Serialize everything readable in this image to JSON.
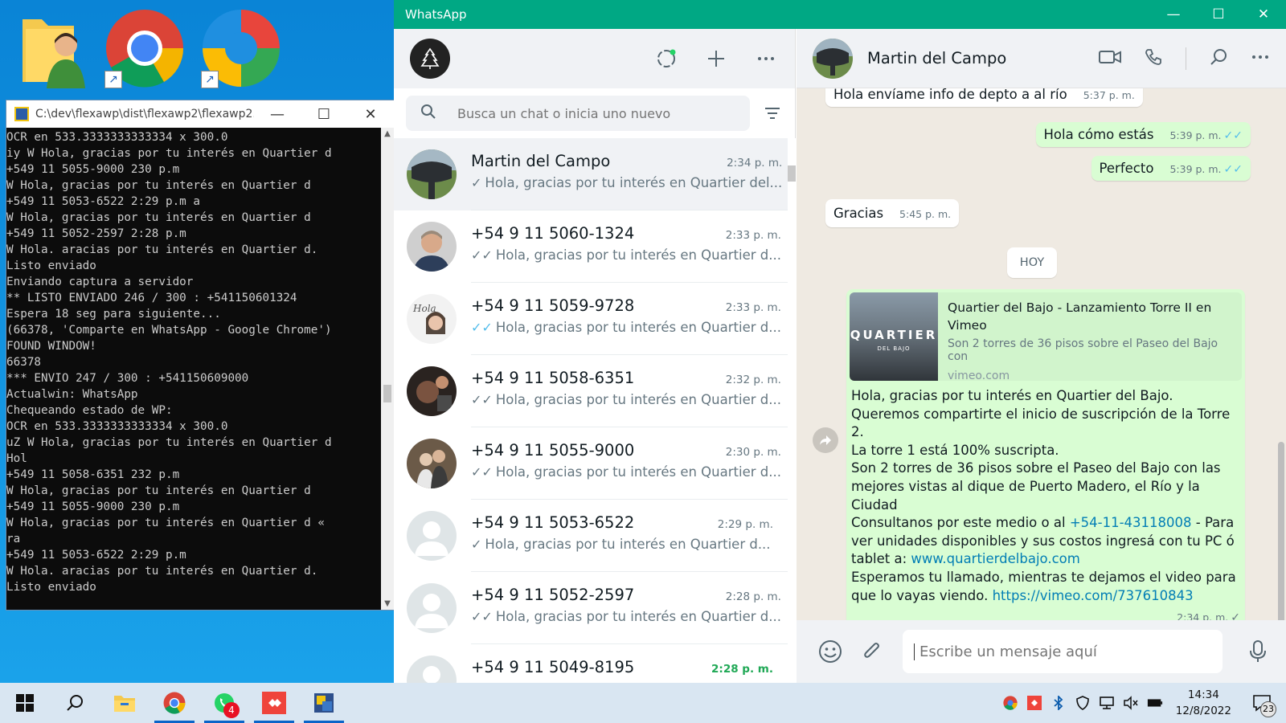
{
  "desktop": {
    "icons": [
      "user-folder-icon",
      "chrome-icon",
      "edge-icon"
    ]
  },
  "console": {
    "title": "C:\\dev\\flexawp\\dist\\flexawp2\\flexawp2....",
    "lines": [
      "OCR en 533.3333333333334 x 300.0",
      "iy W Hola, gracias por tu interés en Quartier d",
      "+549 11 5055-9000 230 p.m",
      "W Hola, gracias por tu interés en Quartier d",
      "+549 11 5053-6522 2:29 p.m a",
      "W Hola, gracias por tu interés en Quartier d",
      "+549 11 5052-2597 2:28 p.m",
      "W Hola. aracias por tu interés en Quartier d.",
      "Listo enviado",
      "Enviando captura a servidor",
      "** LISTO ENVIADO 246 / 300 : +541150601324",
      "Espera 18 seg para siguiente...",
      "(66378, 'Comparte en WhatsApp - Google Chrome')",
      "FOUND WINDOW!",
      "66378",
      "*** ENVIO 247 / 300 : +541150609000",
      "Actualwin: WhatsApp",
      "Chequeando estado de WP:",
      "OCR en 533.3333333333334 x 300.0",
      "uZ W Hola, gracias por tu interés en Quartier d",
      "Hol",
      "+549 11 5058-6351 232 p.m",
      "W Hola, gracias por tu interés en Quartier d",
      "+549 11 5055-9000 230 p.m",
      "W Hola, gracias por tu interés en Quartier d «",
      "ra",
      "+549 11 5053-6522 2:29 p.m",
      "W Hola. aracias por tu interés en Quartier d.",
      "Listo enviado"
    ]
  },
  "whatsapp": {
    "title": "WhatsApp",
    "search_placeholder": "Busca un chat o inicia uno nuevo",
    "chats": [
      {
        "name": "Martin del Campo",
        "time": "2:34 p. m.",
        "preview": "Hola, gracias por tu interés en Quartier del...",
        "tick": "✓",
        "tick_read": false,
        "avatar": "helicopter",
        "active": true
      },
      {
        "name": "+54 9 11 5060-1324",
        "time": "2:33 p. m.",
        "preview": "Hola, gracias por tu interés en Quartier d...",
        "tick": "✓✓",
        "tick_read": false,
        "avatar": "man-photo"
      },
      {
        "name": "+54 9 11 5059-9728",
        "time": "2:33 p. m.",
        "preview": "Hola, gracias por tu interés en Quartier d...",
        "tick": "✓✓",
        "tick_read": true,
        "avatar": "woman-photo"
      },
      {
        "name": "+54 9 11 5058-6351",
        "time": "2:32 p. m.",
        "preview": "Hola, gracias por tu interés en Quartier d...",
        "tick": "✓✓",
        "tick_read": false,
        "avatar": "dark-photo"
      },
      {
        "name": "+54 9 11 5055-9000",
        "time": "2:30 p. m.",
        "preview": "Hola, gracias por tu interés en Quartier d...",
        "tick": "✓✓",
        "tick_read": false,
        "avatar": "couple-photo"
      },
      {
        "name": "+54 9 11 5053-6522",
        "time": "2:29 p. m.",
        "preview": "Hola, gracias por tu interés en Quartier d...",
        "tick": "✓",
        "tick_read": false,
        "avatar": "default"
      },
      {
        "name": "+54 9 11 5052-2597",
        "time": "2:28 p. m.",
        "preview": "Hola, gracias por tu interés en Quartier d...",
        "tick": "✓✓",
        "tick_read": false,
        "avatar": "default"
      },
      {
        "name": "+54 9 11 5049-8195",
        "time": "2:28 p. m.",
        "preview": "",
        "tick": "",
        "tick_read": false,
        "avatar": "default",
        "unread": true
      }
    ],
    "conversation": {
      "contact_name": "Martin del Campo",
      "messages": [
        {
          "dir": "in",
          "text": "Hola envíame info de depto a al río",
          "time": "5:37 p. m."
        },
        {
          "dir": "out",
          "text": "Hola cómo estás",
          "time": "5:39 p. m.",
          "tick": "✓✓"
        },
        {
          "dir": "out",
          "text": "Perfecto",
          "time": "5:39 p. m.",
          "tick": "✓✓"
        },
        {
          "dir": "in",
          "text": "Gracias",
          "time": "5:45 p. m."
        }
      ],
      "day_label": "HOY",
      "link_preview": {
        "title": "Quartier del Bajo - Lanzamiento Torre II en Vimeo",
        "description": "Son 2 torres de 36 pisos sobre el Paseo del Bajo con",
        "domain": "vimeo.com",
        "thumb_text": "QUARTIER",
        "thumb_sub": "DEL BAJO"
      },
      "big_message": {
        "l1": "Hola, gracias por tu interés en Quartier del Bajo.",
        "l2": "Queremos compartirte el inicio de suscripción de la Torre 2.",
        "l3": "La torre 1 está 100% suscripta.",
        "l4": "Son 2 torres de 36 pisos sobre el Paseo del Bajo con las",
        "l5": "mejores vistas al dique de Puerto Madero, el Río y la Ciudad",
        "l6a": "Consultanos por este medio o al ",
        "phone": "+54-11-43118008",
        "l6b": " - Para",
        "l7": "ver unidades disponibles y sus costos ingresá con tu PC ó",
        "l8a": "tablet a: ",
        "site": "www.quartierdelbajo.com",
        "l9": "Esperamos tu llamado, mientras te dejamos el video para",
        "l10a": "que lo vayas viendo. ",
        "vimeo": "https://vimeo.com/737610843",
        "time": "2:34 p. m.",
        "tick": "✓"
      },
      "compose_placeholder": "Escribe un mensaje aquí"
    }
  },
  "taskbar": {
    "whatsapp_badge": "4",
    "time": "14:34",
    "date": "12/8/2022",
    "notification_count": "23"
  }
}
